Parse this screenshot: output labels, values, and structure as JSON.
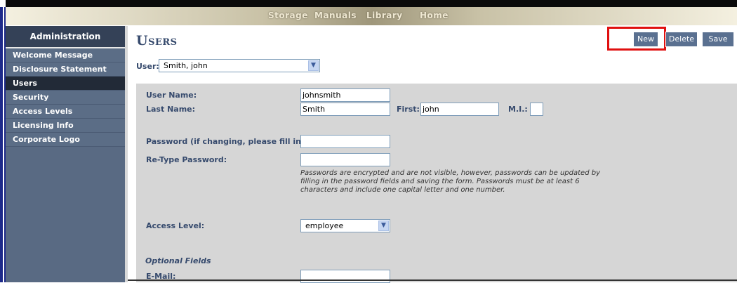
{
  "topnav": {
    "links": [
      "Storage",
      "Manuals",
      "Library",
      "Home"
    ]
  },
  "sidebar": {
    "header": "Administration",
    "items": [
      {
        "label": "Welcome Message"
      },
      {
        "label": "Disclosure Statement"
      },
      {
        "label": "Users"
      },
      {
        "label": "Security"
      },
      {
        "label": "Access Levels"
      },
      {
        "label": "Licensing Info"
      },
      {
        "label": "Corporate Logo"
      }
    ],
    "active_index": 2
  },
  "page": {
    "title": "Users"
  },
  "toolbar": {
    "new_label": "New",
    "delete_label": "Delete",
    "save_label": "Save"
  },
  "user_select": {
    "label": "User:",
    "value": "Smith, john"
  },
  "form": {
    "user_name": {
      "label": "User Name:",
      "value": "johnsmith"
    },
    "last_name": {
      "label": "Last Name:",
      "value": "Smith"
    },
    "first_name": {
      "label": "First:",
      "value": "john"
    },
    "mi": {
      "label": "M.I.:",
      "value": ""
    },
    "password": {
      "label": "Password (if changing, please fill in):",
      "value": ""
    },
    "retype_password": {
      "label": "Re-Type Password:",
      "value": ""
    },
    "password_note": "Passwords are encrypted and are not visible, however, passwords can be updated by filling in the password fields and saving the form. Passwords must be at least 6 characters and include one capital letter and one number.",
    "access_level": {
      "label": "Access Level:",
      "value": "employee"
    },
    "optional_heading": "Optional Fields",
    "email": {
      "label": "E-Mail:",
      "value": ""
    }
  },
  "colors": {
    "highlight": "#e01010",
    "sidebar_active": "#222a37",
    "button": "#5a7090"
  }
}
